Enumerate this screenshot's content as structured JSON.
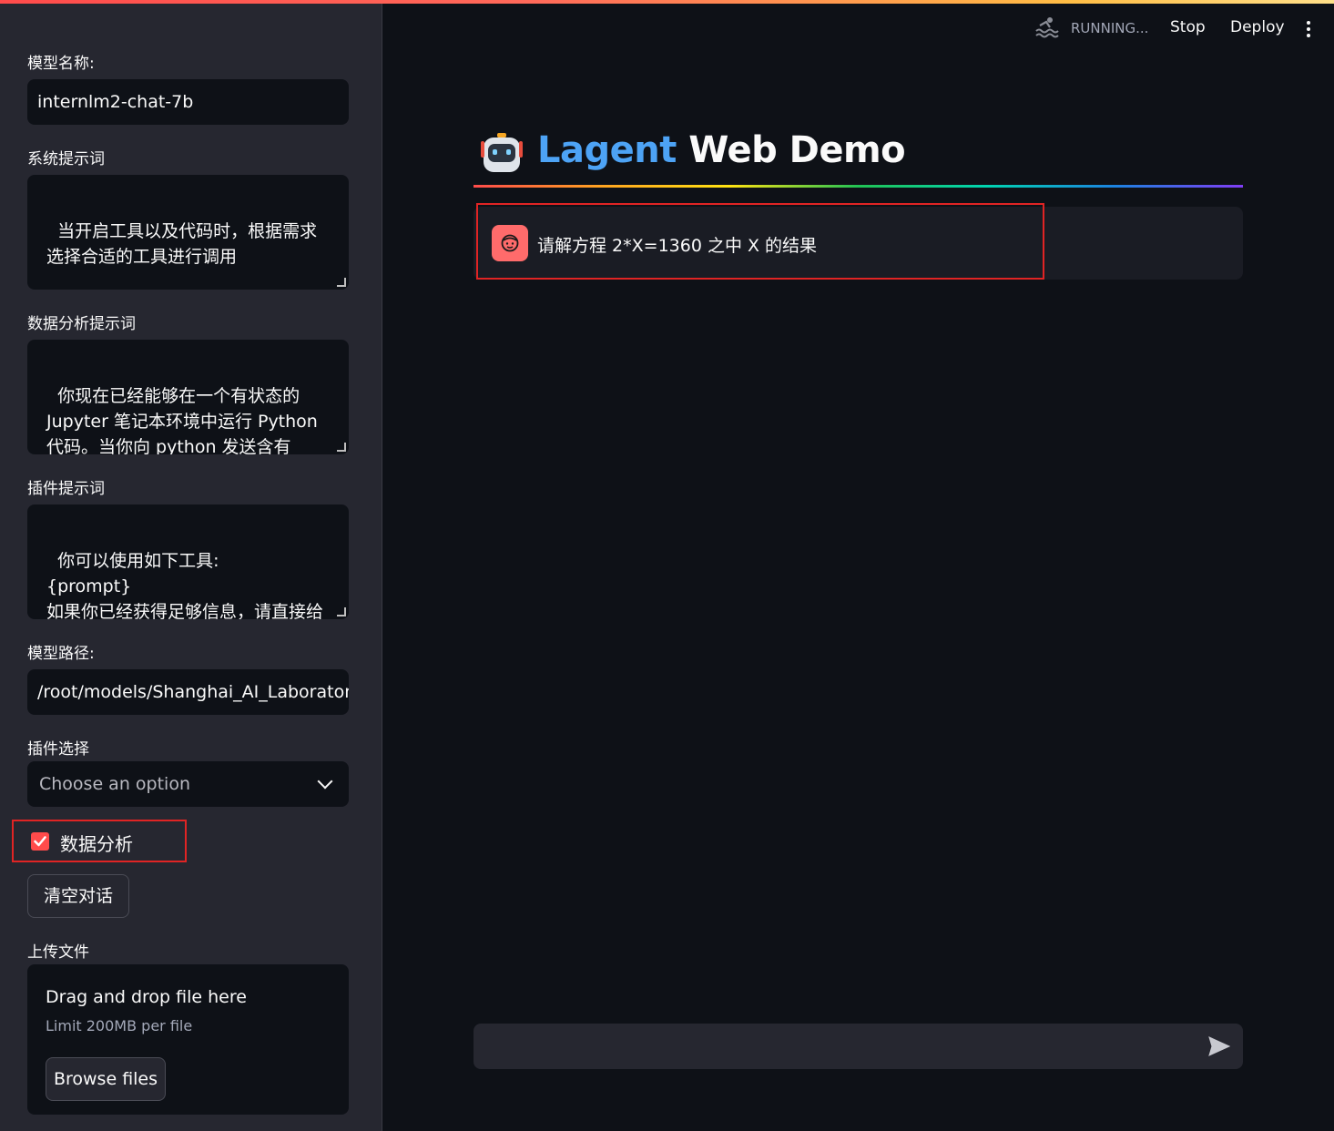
{
  "header": {
    "status": "RUNNING...",
    "stop_label": "Stop",
    "deploy_label": "Deploy"
  },
  "sidebar": {
    "model_name": {
      "label": "模型名称:",
      "value": "internlm2-chat-7b"
    },
    "system_prompt": {
      "label": "系统提示词",
      "value": "当开启工具以及代码时，根据需求选择合适的工具进行调用"
    },
    "data_analysis_prompt": {
      "label": "数据分析提示词",
      "value": "你现在已经能够在一个有状态的 Jupyter 笔记本环境中运行 Python 代码。当你向 python 发送含有 Python 代码的消息时，它将在该"
    },
    "plugin_prompt": {
      "label": "插件提示词",
      "value": "你可以使用如下工具:\n{prompt}\n如果你已经获得足够信息，请直接给出答案. 避免不必要的工具调用!"
    },
    "model_path": {
      "label": "模型路径:",
      "value": "/root/models/Shanghai_AI_Laboratory/"
    },
    "plugin_select": {
      "label": "插件选择",
      "placeholder": "Choose an option"
    },
    "data_analysis_checkbox": {
      "label": "数据分析",
      "checked": true
    },
    "clear_button": "清空对话",
    "upload": {
      "label": "上传文件",
      "drop_text": "Drag and drop file here",
      "limit_text": "Limit 200MB per file",
      "browse_label": "Browse files"
    }
  },
  "main": {
    "title_accent": "Lagent",
    "title_rest": " Web Demo",
    "messages": [
      {
        "role": "user",
        "text": "请解方程 2*X=1360 之中 X 的结果"
      }
    ],
    "chat_input": {
      "value": ""
    }
  },
  "colors": {
    "accent": "#ff4b4b",
    "title_accent": "#4da3f5",
    "background": "#0e1117",
    "sidebar": "#262730"
  }
}
